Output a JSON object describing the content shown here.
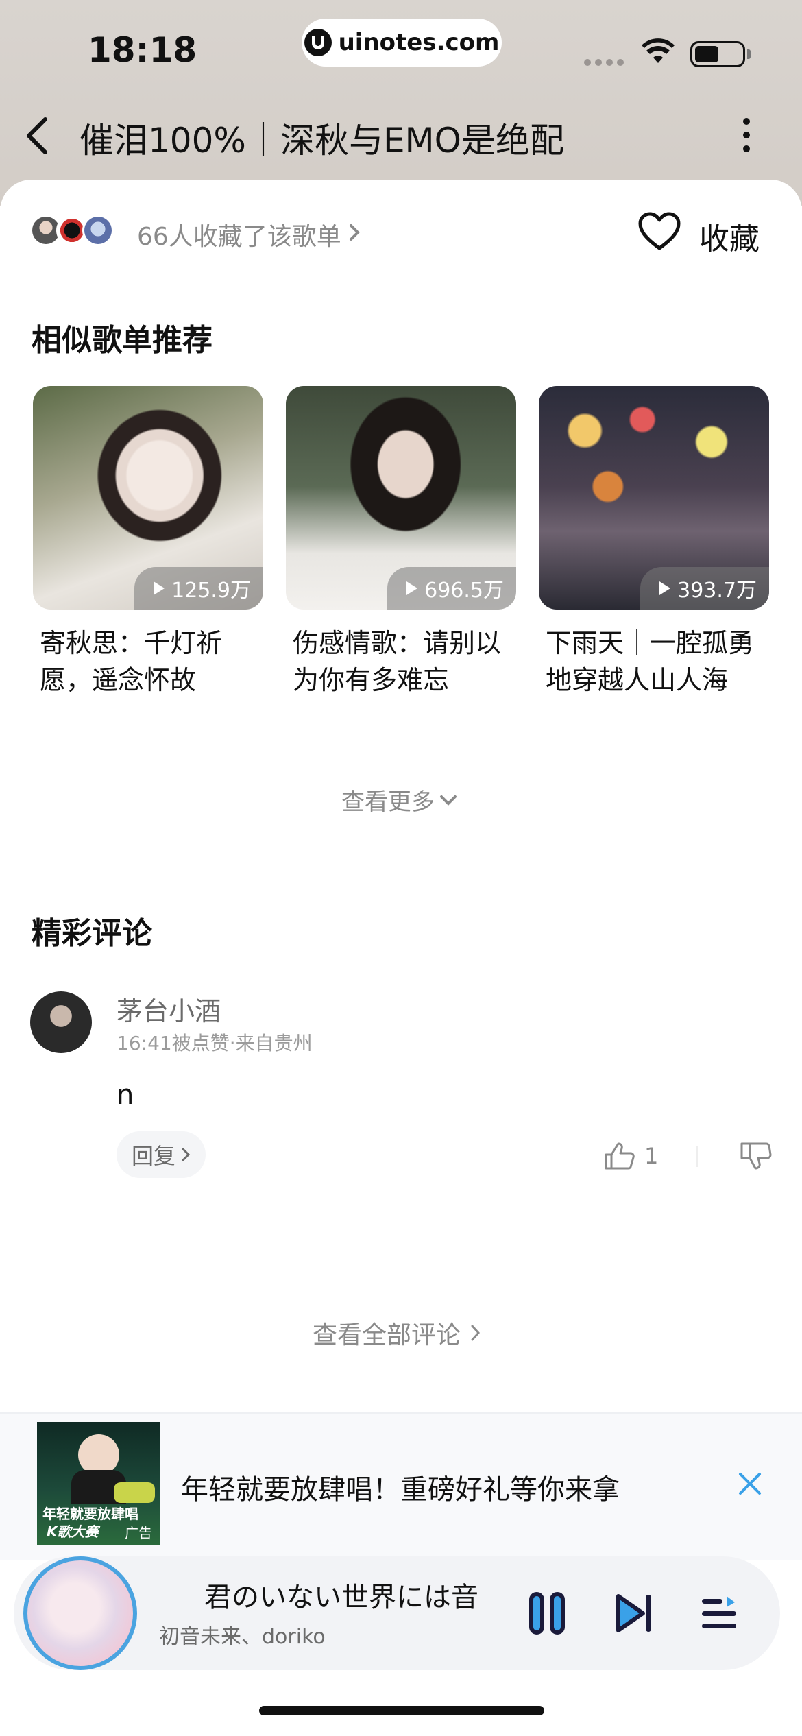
{
  "status_bar": {
    "time": "18:18",
    "url": "uinotes.com"
  },
  "header": {
    "title": "催泪100%｜深秋与EMO是绝配"
  },
  "collect": {
    "text": "66人收藏了该歌单",
    "button_label": "收藏"
  },
  "similar": {
    "title": "相似歌单推荐",
    "items": [
      {
        "title_line1": "寄秋思：千灯祈",
        "title_line2": "愿，遥念怀故",
        "plays": "125.9万"
      },
      {
        "title_line1": "伤感情歌：请别以",
        "title_line2": "为你有多难忘",
        "plays": "696.5万"
      },
      {
        "title_line1": "下雨天｜一腔孤勇",
        "title_line2": "地穿越人山人海",
        "plays": "393.7万"
      }
    ],
    "see_more": "查看更多"
  },
  "comments": {
    "title": "精彩评论",
    "items": [
      {
        "user": "茅台小酒",
        "meta": "16:41被点赞·来自贵州",
        "body": "n",
        "reply": "回复",
        "likes": "1"
      }
    ],
    "see_all": "查看全部评论"
  },
  "ad": {
    "text": "年轻就要放肆唱！重磅好礼等你来拿",
    "image_line1": "年轻就要放肆唱",
    "image_line2": "K歌大赛",
    "tag": "广告"
  },
  "player": {
    "title": "君のいない世界には音",
    "artist": "初音未来、doriko"
  },
  "colors": {
    "accent": "#3aa1e8",
    "muted": "#8a8a8a"
  }
}
